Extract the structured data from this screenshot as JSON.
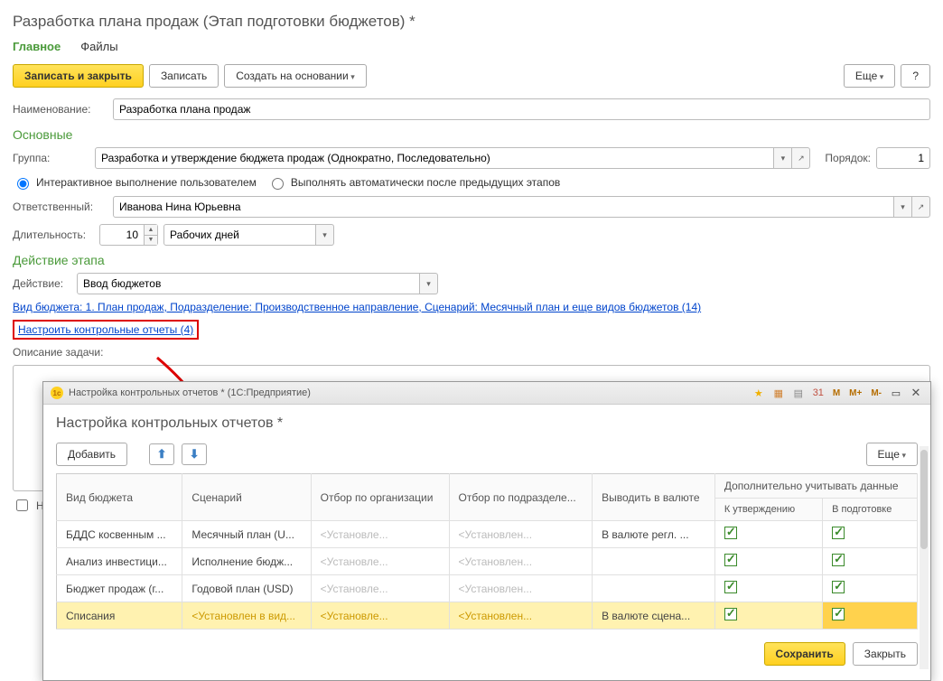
{
  "page": {
    "title": "Разработка плана продаж (Этап подготовки бюджетов) *",
    "tabs": {
      "main": "Главное",
      "files": "Файлы"
    },
    "toolbar": {
      "save_close": "Записать и закрыть",
      "save": "Записать",
      "create_based": "Создать на основании",
      "more": "Еще",
      "help": "?"
    },
    "labels": {
      "name": "Наименование:",
      "group": "Группа:",
      "order": "Порядок:",
      "responsible": "Ответственный:",
      "duration": "Длительность:",
      "action": "Действие:",
      "task_desc": "Описание задачи:"
    },
    "sections": {
      "main": "Основные",
      "stage_action": "Действие этапа"
    },
    "values": {
      "name": "Разработка плана продаж",
      "group": "Разработка и утверждение бюджета продаж (Однократно, Последовательно)",
      "order": "1",
      "responsible": "Иванова Нина Юрьевна",
      "duration": "10",
      "duration_unit": "Рабочих дней",
      "action": "Ввод бюджетов"
    },
    "radios": {
      "interactive": "Интерактивное выполнение пользователем",
      "auto": "Выполнять автоматически после предыдущих этапов"
    },
    "links": {
      "budget_kind": "Вид бюджета: 1. План продаж, Подразделение: Производственное направление, Сценарий: Месячный план и еще видов бюджетов (14)",
      "configure_reports": "Настроить контрольные отчеты (4)"
    },
    "checkbox_bottom": "Н"
  },
  "dialog": {
    "titlebar": "Настройка контрольных отчетов *  (1С:Предприятие)",
    "header": "Настройка контрольных отчетов *",
    "toolbar": {
      "add": "Добавить",
      "more": "Еще"
    },
    "columns": {
      "budget": "Вид бюджета",
      "scenario": "Сценарий",
      "org_filter": "Отбор по организации",
      "dept_filter": "Отбор по подразделе...",
      "currency": "Выводить в валюте",
      "extra": "Дополнительно учитывать данные",
      "approve": "К утверждению",
      "prep": "В подготовке"
    },
    "placeholder": {
      "org": "<Установле...",
      "dept": "<Установлен...",
      "scen": "<Установлен в вид..."
    },
    "rows": [
      {
        "budget": "БДДС косвенным ...",
        "scenario": "Месячный план (U...",
        "currency": "В валюте регл. ...",
        "approve": true,
        "prep": true
      },
      {
        "budget": "Анализ инвестици...",
        "scenario": "Исполнение бюдж...",
        "currency": "",
        "approve": true,
        "prep": true
      },
      {
        "budget": "Бюджет продаж (г...",
        "scenario": "Годовой план (USD)",
        "currency": "",
        "approve": true,
        "prep": true
      },
      {
        "budget": "Списания",
        "scenario": "",
        "currency": "В валюте сцена...",
        "approve": true,
        "prep": true
      }
    ],
    "footer": {
      "save": "Сохранить",
      "close": "Закрыть"
    },
    "tb_icons": {
      "m": "M",
      "mp": "M+",
      "mm": "M-"
    }
  }
}
